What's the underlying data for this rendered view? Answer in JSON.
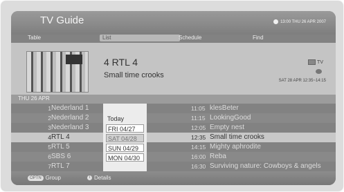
{
  "header": {
    "title": "TV Guide",
    "datetime": "13:00 THU 26 APR 2007"
  },
  "tabs": [
    {
      "label": "Table"
    },
    {
      "label": "List"
    },
    {
      "label": "Schedule"
    },
    {
      "label": "Find"
    }
  ],
  "selected_program": {
    "channel": "4 RTL 4",
    "title": "Small time crooks",
    "source": "TV",
    "broadcast": "SAT 28 APR 12:35~14:15"
  },
  "date_header": "THU 26 APR",
  "channels": [
    {
      "num": "1",
      "name": "Nederland 1",
      "time": "11:05",
      "program": "klesBeter"
    },
    {
      "num": "2",
      "name": "Nederland 2",
      "time": "11:15",
      "program": "LookingGood"
    },
    {
      "num": "3",
      "name": "Nederland 3",
      "time": "12:05",
      "program": "Empty nest"
    },
    {
      "num": "4",
      "name": "RTL 4",
      "time": "12:35",
      "program": "Small time crooks"
    },
    {
      "num": "5",
      "name": "RTL 5",
      "time": "14:15",
      "program": "Mighty aphrodite"
    },
    {
      "num": "6",
      "name": "SBS 6",
      "time": "16:00",
      "program": "Reba"
    },
    {
      "num": "7",
      "name": "RTL 7",
      "time": "16:30",
      "program": "Surviving nature: Cowboys & angels"
    }
  ],
  "days": [
    {
      "label": "Today"
    },
    {
      "label": "FRI  04/27"
    },
    {
      "label": "SAT  04/28"
    },
    {
      "label": "SUN  04/29"
    },
    {
      "label": "MON 04/30"
    }
  ],
  "footer": {
    "group_key": "OPTN",
    "group_label": "Group",
    "details_key": "i",
    "details_label": "Details"
  }
}
